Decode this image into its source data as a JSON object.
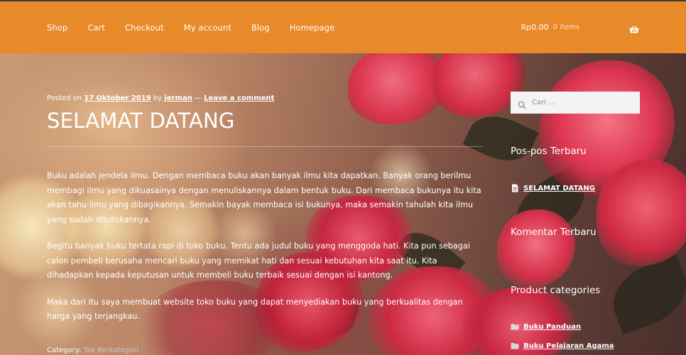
{
  "header": {
    "nav": [
      "Shop",
      "Cart",
      "Checkout",
      "My account",
      "Blog",
      "Homepage"
    ],
    "cart": {
      "amount": "Rp0.00",
      "count": "0 items",
      "icon": "basket-icon"
    },
    "accent_color": "#e8892a"
  },
  "post": {
    "meta": {
      "posted_on": "Posted on",
      "date": "17 Oktober 2019",
      "by": "by",
      "author": "jerman",
      "dash": "—",
      "comment": "Leave a comment"
    },
    "title": "SELAMAT DATANG",
    "paragraphs": [
      "Buku adalah jendela ilmu. Dengan membaca buku akan banyak ilmu kita dapatkan. Banyak orang berilmu membagi ilmu yang dikuasainya dengan menuliskannya dalam bentuk buku. Dari membaca bukunya itu kita akan tahu ilmu yang dibagikannya. Semakin bayak membaca isi bukunya, maka semakin tahulah kita ilmu yang sudah dituliskannya.",
      "Begitu banyak buku tertata rapi di toko buku. Tentu ada judul buku yang menggoda hati. Kita pun sebagai calon pembeli berusaha mencari buku yang memikat hati dan sesuai kebutuhan kita saat itu. Kita dihadapkan kepada keputusan untuk membeli buku terbaik sesuai dengan isi kantong.",
      "Maka dari itu saya membuat website toko buku yang dapat menyediakan buku yang berkualitas dengan harga yang terjangkau."
    ],
    "category_label": "Category:",
    "category_value": "Tak Berkategori"
  },
  "sidebar": {
    "search_placeholder": "Cari …",
    "recent_posts_title": "Pos-pos Terbaru",
    "recent_posts": [
      "SELAMAT DATANG"
    ],
    "recent_comments_title": "Komentar Terbaru",
    "product_categories_title": "Product categories",
    "product_categories": [
      "Buku Panduan",
      "Buku Pelajaran Agama"
    ]
  }
}
